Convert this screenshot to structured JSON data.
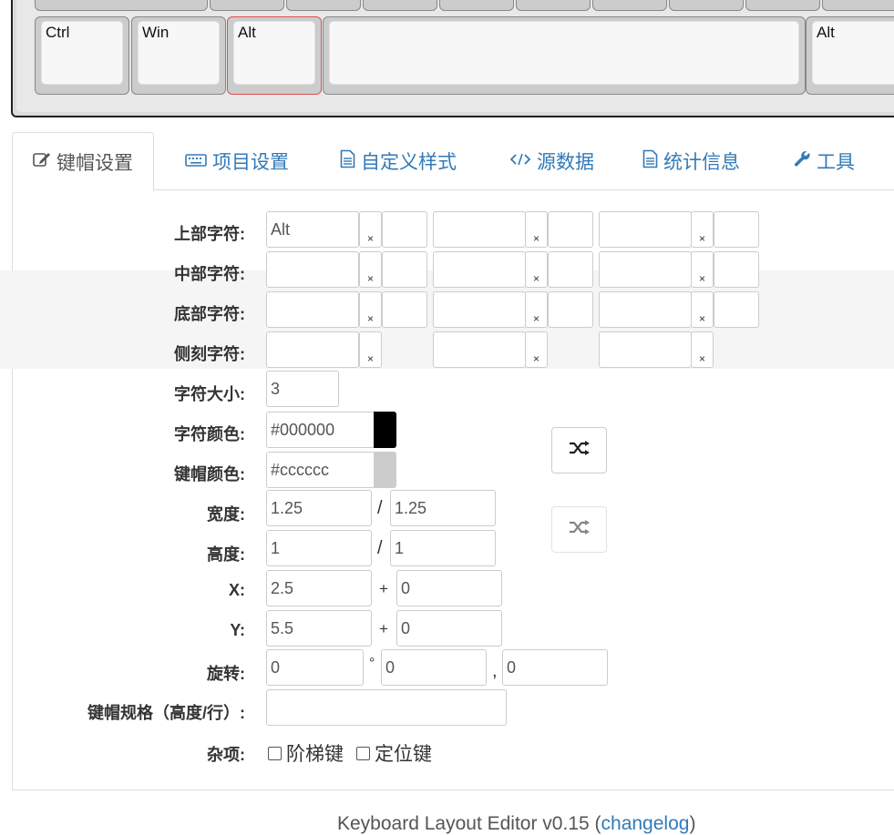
{
  "keyboard": {
    "keys": [
      {
        "label": "Ctrl",
        "selected": false
      },
      {
        "label": "Win",
        "selected": false
      },
      {
        "label": "Alt",
        "selected": true
      },
      {
        "label": "",
        "selected": false
      },
      {
        "label": "Alt",
        "selected": false
      }
    ]
  },
  "tabs": [
    {
      "label": "键帽设置",
      "icon": "edit-icon",
      "active": true
    },
    {
      "label": "项目设置",
      "icon": "keyboard-icon",
      "active": false
    },
    {
      "label": "自定义样式",
      "icon": "file-icon",
      "active": false
    },
    {
      "label": "源数据",
      "icon": "code-icon",
      "active": false
    },
    {
      "label": "统计信息",
      "icon": "file-icon",
      "active": false
    },
    {
      "label": "工具",
      "icon": "wrench-icon",
      "active": false
    }
  ],
  "form": {
    "top_legend": {
      "label": "上部字符:",
      "values": [
        "Alt",
        "",
        ""
      ]
    },
    "center_legend": {
      "label": "中部字符:",
      "values": [
        "",
        "",
        ""
      ]
    },
    "bottom_legend": {
      "label": "底部字符:",
      "values": [
        "",
        "",
        ""
      ]
    },
    "side_legend": {
      "label": "侧刻字符:",
      "values": [
        "",
        "",
        ""
      ]
    },
    "clear_glyph": "×",
    "font_size": {
      "label": "字符大小:",
      "value": "3"
    },
    "text_color": {
      "label": "字符颜色:",
      "value": "#000000",
      "swatch": "#000000"
    },
    "key_color": {
      "label": "键帽颜色:",
      "value": "#cccccc",
      "swatch": "#cccccc"
    },
    "width": {
      "label": "宽度:",
      "value": "1.25",
      "value2": "1.25",
      "sep": "/"
    },
    "height": {
      "label": "高度:",
      "value": "1",
      "value2": "1",
      "sep": "/"
    },
    "x": {
      "label": "X:",
      "value": "2.5",
      "value2": "0",
      "sep": "+"
    },
    "y": {
      "label": "Y:",
      "value": "5.5",
      "value2": "0",
      "sep": "+"
    },
    "rotation": {
      "label": "旋转:",
      "value": "0",
      "value2": "0",
      "value3": "0",
      "sep1": "°",
      "sep2": ","
    },
    "profile": {
      "label": "键帽规格（高度/行）:",
      "value": ""
    },
    "misc": {
      "label": "杂项:",
      "stepped": "阶梯键",
      "homing": "定位键"
    }
  },
  "footer": {
    "text": "Keyboard Layout Editor v0.15 (",
    "link": "changelog",
    "close": ")"
  }
}
